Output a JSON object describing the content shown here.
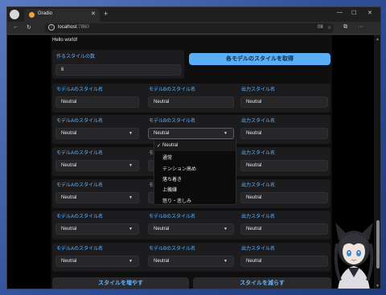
{
  "browser": {
    "tab_title": "Gradio",
    "tab_close": "✕",
    "new_tab": "+",
    "minimize": "—",
    "maximize": "☐",
    "close": "✕",
    "back": "←",
    "reload": "↻",
    "address_host": "localhost",
    "address_port": ":7860",
    "address_info": "i",
    "zoom_badge": "08",
    "star": "☆",
    "extensions": "⧉",
    "menu": "···"
  },
  "app": {
    "hello": "Hello world!",
    "num_styles_label": "作るスタイルの数",
    "num_styles_value": "6",
    "get_styles_button": "各モデルのスタイルを取得",
    "increase_button": "スタイルを増やす",
    "decrease_button": "スタイルを減らす",
    "rows": [
      {
        "a_label": "モデルAのスタイル名",
        "a_value": "Neutral",
        "b_label": "モデルBのスタイル名",
        "b_value": "Neutral",
        "out_label": "出力スタイル名",
        "out_value": "Neutral"
      },
      {
        "a_label": "モデルAのスタイル名",
        "a_value": "Neutral",
        "b_label": "モデルBのスタイル名",
        "b_value": "Neutral",
        "out_label": "出力スタイル名",
        "out_value": "Neutral"
      },
      {
        "a_label": "モデルAのスタイル名",
        "a_value": "Neutral",
        "b_label": "モデルBのスタイル名",
        "b_value": "Neutral",
        "out_label": "出力スタイル名",
        "out_value": "Neutral"
      },
      {
        "a_label": "モデルAのスタイル名",
        "a_value": "Neutral",
        "b_label": "モデルBのスタイル名",
        "b_value": "Neutral",
        "out_label": "出力スタイル名",
        "out_value": "Neutral"
      },
      {
        "a_label": "モデルAのスタイル名",
        "a_value": "Neutral",
        "b_label": "モデルBのスタイル名",
        "b_value": "Neutral",
        "out_label": "出力スタイル名",
        "out_value": "Neutral"
      },
      {
        "a_label": "モデルAのスタイル名",
        "a_value": "Neutral",
        "b_label": "モデルBのスタイル名",
        "b_value": "Neutral",
        "out_label": "出力スタイル名",
        "out_value": "Neutral"
      }
    ],
    "dropdown_caret": "▼",
    "dropdown_check": "✓",
    "dropdown_options": [
      "Neutral",
      "通常",
      "テンション高め",
      "落ち着き",
      "上機嫌",
      "怒り・悲しみ"
    ]
  },
  "colors": {
    "accent": "#5aaef5",
    "label": "#5fb4ff"
  }
}
